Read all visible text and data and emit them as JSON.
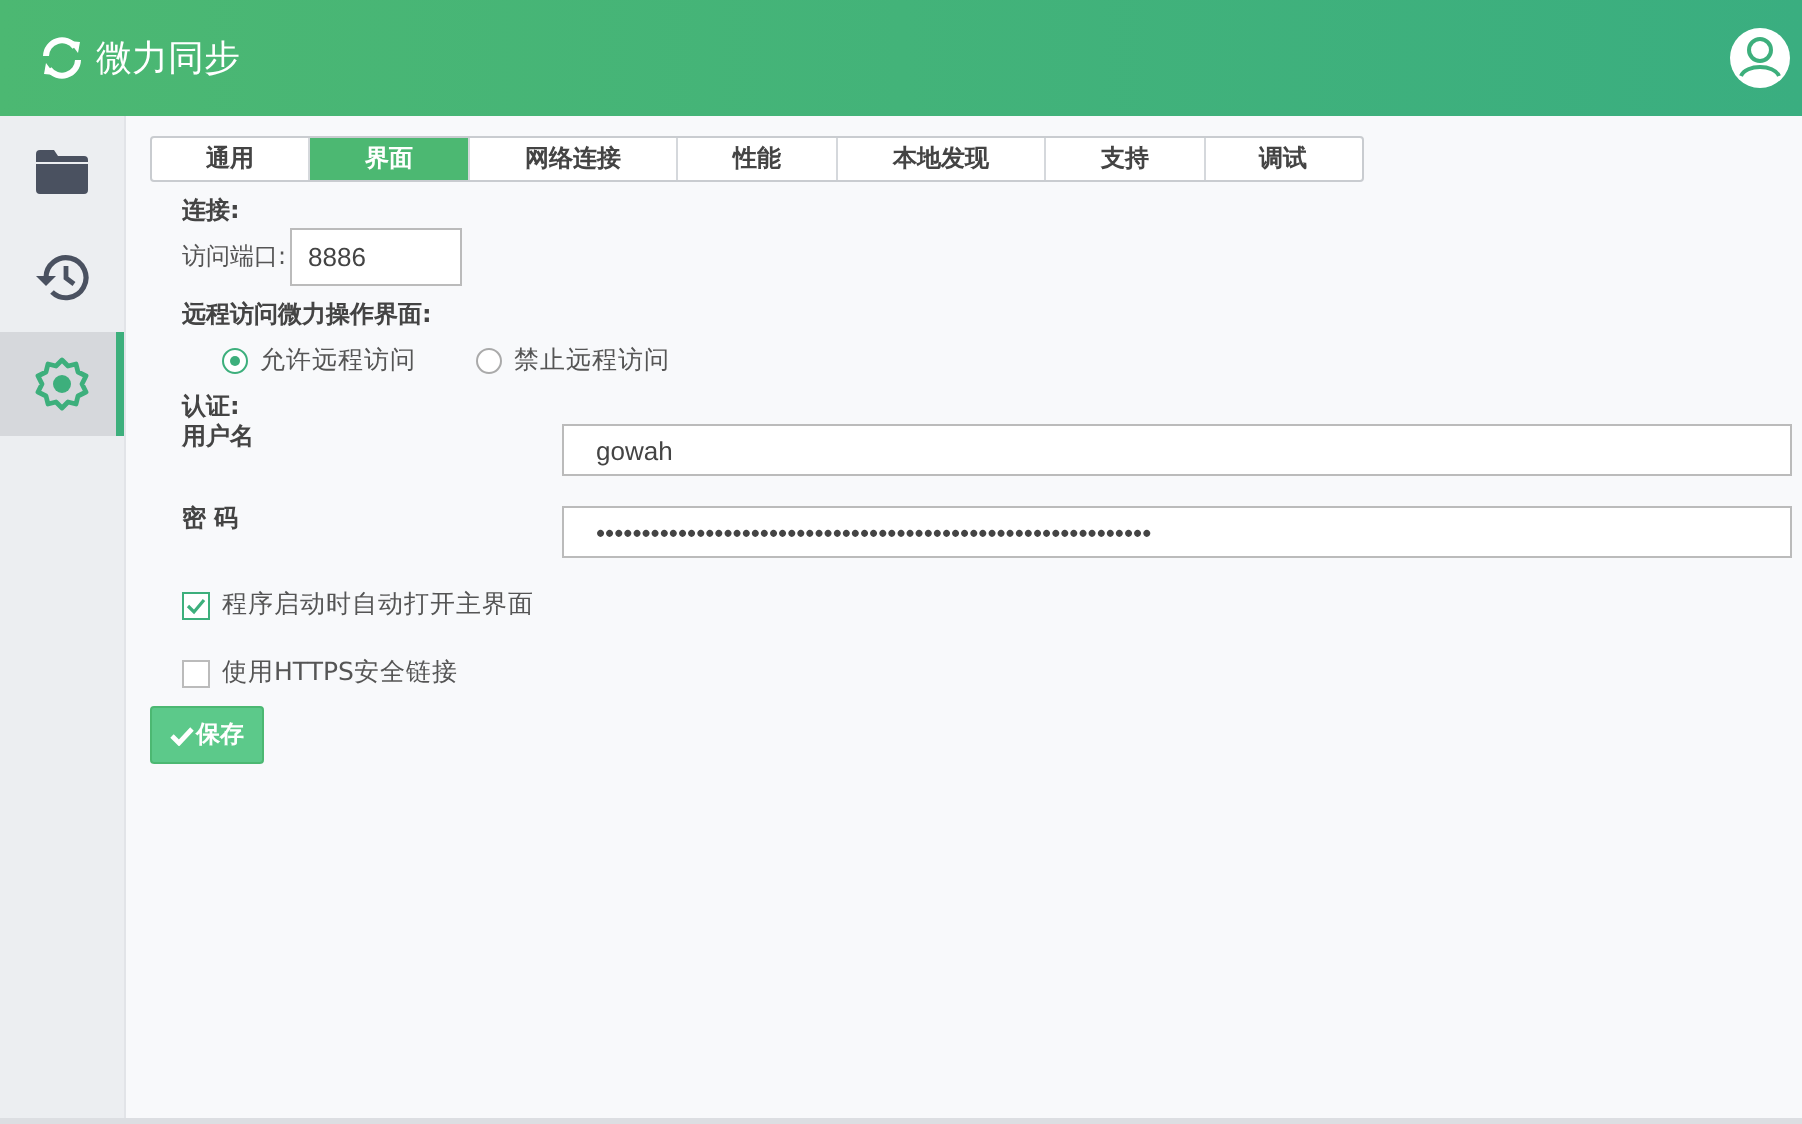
{
  "app": {
    "title": "微力同步"
  },
  "sidebar": {
    "items": [
      {
        "selected": false
      },
      {
        "selected": false
      },
      {
        "selected": true
      }
    ]
  },
  "tabs": [
    {
      "label": "通用",
      "selected": false
    },
    {
      "label": "界面",
      "selected": true
    },
    {
      "label": "网络连接",
      "selected": false
    },
    {
      "label": "性能",
      "selected": false
    },
    {
      "label": "本地发现",
      "selected": false
    },
    {
      "label": "支持",
      "selected": false
    },
    {
      "label": "调试",
      "selected": false
    }
  ],
  "connection": {
    "heading": "连接:",
    "port_label": "访问端口:",
    "port_value": "8886"
  },
  "remote": {
    "heading": "远程访问微力操作界面:",
    "options": [
      {
        "label": "允许远程访问",
        "selected": true
      },
      {
        "label": "禁止远程访问",
        "selected": false
      }
    ]
  },
  "auth": {
    "heading": "认证:",
    "username_label": "用户名",
    "username_value": "gowah",
    "password_label": "密 码",
    "password_value": "•••••••••••••••••••••••••••••••••••••••••••••••••••••••••••••"
  },
  "checkboxes": [
    {
      "label": "程序启动时自动打开主界面",
      "checked": true
    },
    {
      "label": "使用HTTPS安全链接",
      "checked": false
    }
  ],
  "save_button": {
    "label": "保存"
  }
}
